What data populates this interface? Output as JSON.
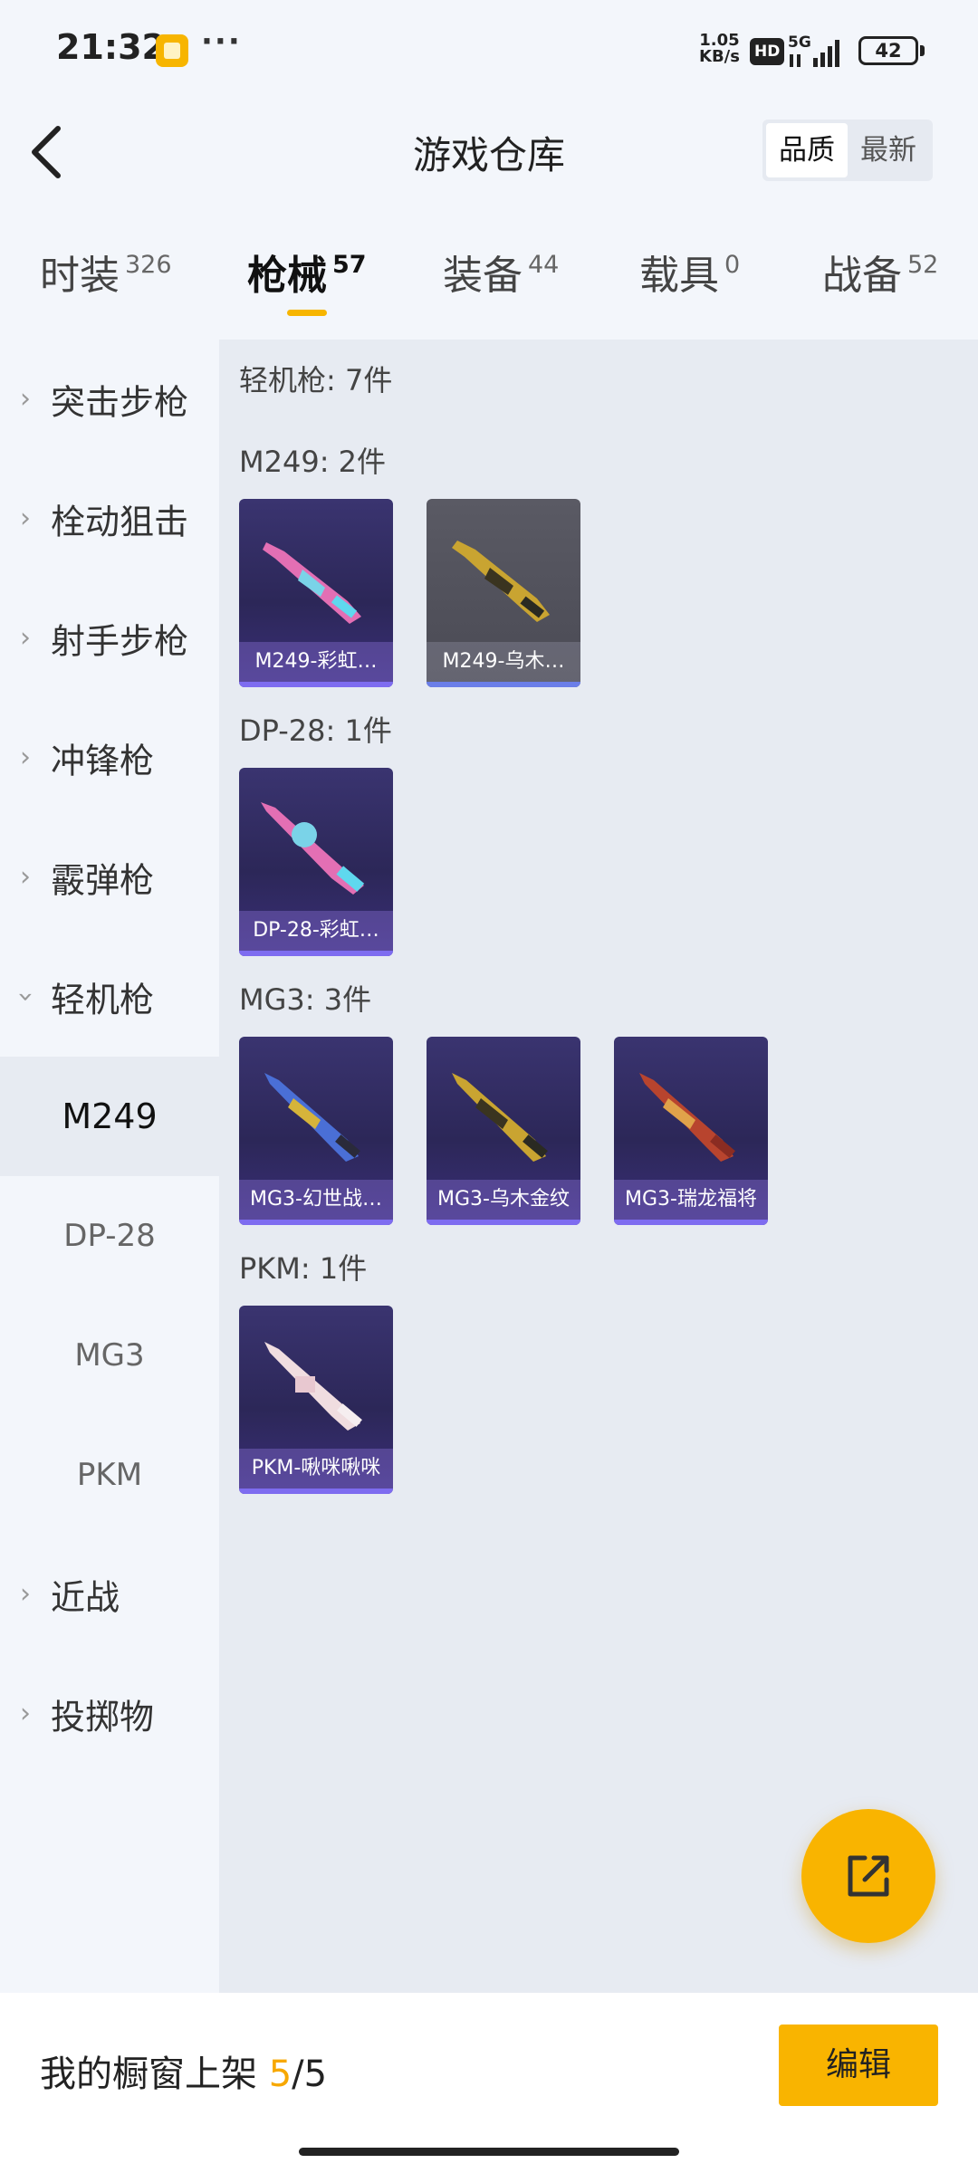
{
  "status_bar": {
    "time": "21:32",
    "speed_value": "1.05",
    "speed_unit": "KB/s",
    "hd": "HD",
    "network": "5G",
    "battery": "42"
  },
  "header": {
    "title": "游戏仓库",
    "sort_options": [
      "品质",
      "最新"
    ],
    "sort_selected": "品质"
  },
  "tabs": [
    {
      "label": "时装",
      "count": "326"
    },
    {
      "label": "枪械",
      "count": "57",
      "active": true
    },
    {
      "label": "装备",
      "count": "44"
    },
    {
      "label": "载具",
      "count": "0"
    },
    {
      "label": "战备",
      "count": "52"
    }
  ],
  "sidebar": {
    "categories": [
      "突击步枪",
      "栓动狙击",
      "射手步枪",
      "冲锋枪",
      "霰弹枪",
      "轻机枪",
      "近战",
      "投掷物"
    ],
    "expanded": "轻机枪",
    "subitems": [
      "M249",
      "DP-28",
      "MG3",
      "PKM"
    ],
    "selected_sub": "M249"
  },
  "content": {
    "total": "轻机枪: 7件",
    "groups": [
      {
        "title": "M249: 2件",
        "items": [
          "M249-彩虹…",
          "M249-乌木…"
        ]
      },
      {
        "title": "DP-28: 1件",
        "items": [
          "DP-28-彩虹…"
        ]
      },
      {
        "title": "MG3: 3件",
        "items": [
          "MG3-幻世战…",
          "MG3-乌木金纹",
          "MG3-瑞龙福将"
        ]
      },
      {
        "title": "PKM: 1件",
        "items": [
          "PKM-啾咪啾咪"
        ]
      }
    ]
  },
  "bottom": {
    "showcase_label": "我的橱窗上架",
    "showcase_used": "5",
    "showcase_total": "/5",
    "edit_label": "编辑"
  },
  "icons": {
    "back": "chevron-left-icon",
    "share": "share-external-icon",
    "chevron_collapsed": "chevron-right-icon",
    "chevron_expanded": "chevron-down-icon"
  },
  "colors": {
    "accent": "#f9b400",
    "card_purple": "#2c2758",
    "card_grey": "#4a4a54"
  }
}
